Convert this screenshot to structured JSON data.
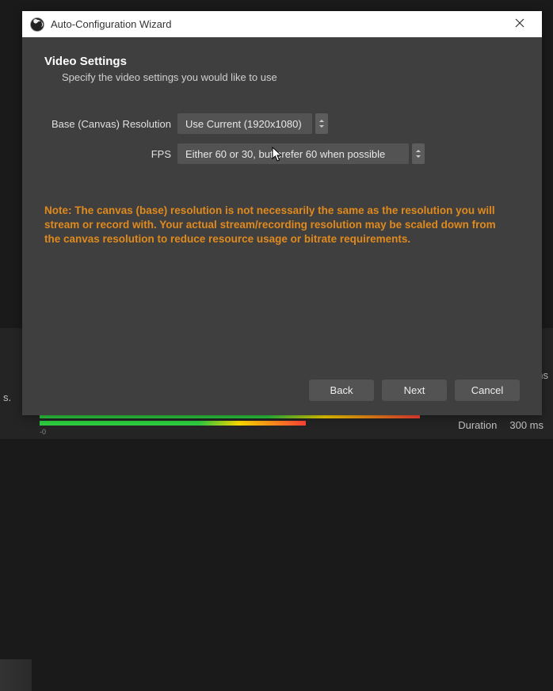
{
  "titlebar": {
    "title": "Auto-Configuration Wizard"
  },
  "page": {
    "heading": "Video Settings",
    "subheading": "Specify the video settings you would like to use"
  },
  "form": {
    "resolution_label": "Base (Canvas) Resolution",
    "resolution_value": "Use Current (1920x1080)",
    "fps_label": "FPS",
    "fps_value": "Either 60 or 30, but prefer 60 when possible"
  },
  "note": "Note: The canvas (base) resolution is not necessarily the same as the resolution you will stream or record with. Your actual stream/recording resolution may be scaled down from the canvas resolution to reduce resource usage or bitrate requirements.",
  "buttons": {
    "back": "Back",
    "next": "Next",
    "cancel": "Cancel"
  },
  "background": {
    "partial": "ns",
    "dot": "s.",
    "duration_label": "Duration",
    "duration_value": "300 ms",
    "ticks": [
      "-0"
    ]
  }
}
